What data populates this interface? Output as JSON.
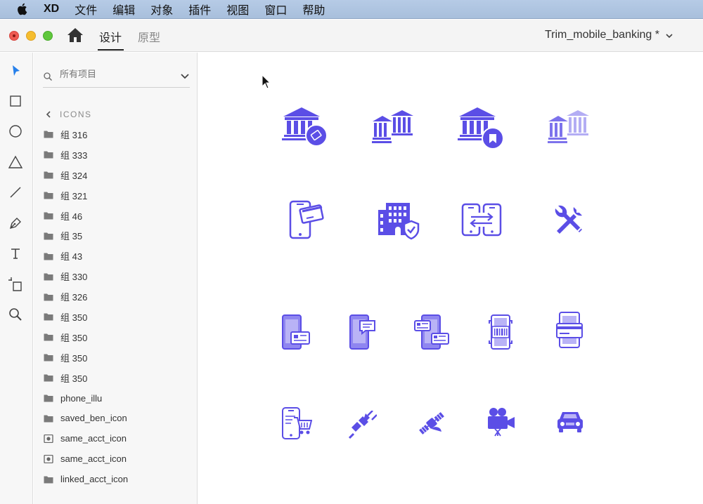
{
  "menubar": {
    "app_name": "XD",
    "items": [
      "文件",
      "编辑",
      "对象",
      "插件",
      "视图",
      "窗口",
      "帮助"
    ]
  },
  "titlebar": {
    "tab_design": "设计",
    "tab_prototype": "原型",
    "document_title": "Trim_mobile_banking *"
  },
  "tools": [
    "select-tool-icon",
    "rectangle-tool-icon",
    "ellipse-tool-icon",
    "polygon-tool-icon",
    "line-tool-icon",
    "pen-tool-icon",
    "text-tool-icon",
    "artboard-tool-icon",
    "zoom-tool-icon"
  ],
  "layers": {
    "search_placeholder": "所有项目",
    "breadcrumb": "ICONS",
    "items": [
      {
        "label": "组 316",
        "type": "folder"
      },
      {
        "label": "组 333",
        "type": "folder"
      },
      {
        "label": "组 324",
        "type": "folder"
      },
      {
        "label": "组 321",
        "type": "folder"
      },
      {
        "label": "组 46",
        "type": "folder"
      },
      {
        "label": "组 35",
        "type": "folder"
      },
      {
        "label": "组 43",
        "type": "folder"
      },
      {
        "label": "组 330",
        "type": "folder"
      },
      {
        "label": "组 326",
        "type": "folder"
      },
      {
        "label": "组 350",
        "type": "folder"
      },
      {
        "label": "组 350",
        "type": "folder"
      },
      {
        "label": "组 350",
        "type": "folder"
      },
      {
        "label": "组 350",
        "type": "folder"
      },
      {
        "label": "phone_illu",
        "type": "folder"
      },
      {
        "label": "saved_ben_icon",
        "type": "folder"
      },
      {
        "label": "same_acct_icon",
        "type": "symbol"
      },
      {
        "label": "same_acct_icon",
        "type": "symbol"
      },
      {
        "label": "linked_acct_icon",
        "type": "folder"
      }
    ]
  },
  "canvas": {
    "icon_color": "#5b4ee6",
    "icon_color_light": "#8f86f0",
    "icons": [
      "bank-ticket-icon",
      "bank-pair-icon",
      "bank-bookmark-icon",
      "bank-pair-faded-icon",
      "phone-card-icon",
      "building-shield-icon",
      "phone-transfer-icon",
      "tools-icon",
      "phone-message-card-icon",
      "phone-chat-icon",
      "phone-cards-icon",
      "phone-barcode-icon",
      "phone-card-scan-icon",
      "phone-cart-icon",
      "plug-icon",
      "satellite-icon",
      "video-camera-icon",
      "car-icon"
    ]
  },
  "colors": {
    "menubar_bg": "#aec4e1",
    "panel_bg": "#f7f7f7",
    "select_tool": "#2680eb"
  }
}
